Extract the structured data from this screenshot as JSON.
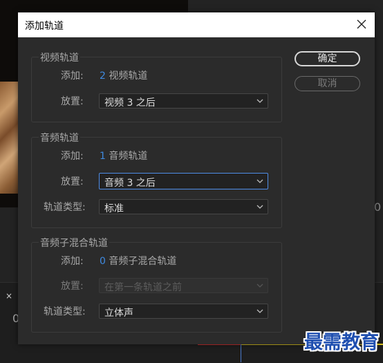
{
  "dialog": {
    "title": "添加轨道",
    "ok_label": "确定",
    "cancel_label": "取消"
  },
  "video": {
    "group_title": "视频轨道",
    "add_label": "添加:",
    "add_count": "2",
    "add_unit": "视频轨道",
    "placement_label": "放置:",
    "placement_value": "视频 3 之后"
  },
  "audio": {
    "group_title": "音频轨道",
    "add_label": "添加:",
    "add_count": "1",
    "add_unit": "音频轨道",
    "placement_label": "放置:",
    "placement_value": "音频 3 之后",
    "track_type_label": "轨道类型:",
    "track_type_value": "标准"
  },
  "submix": {
    "group_title": "音频子混合轨道",
    "add_label": "添加:",
    "add_count": "0",
    "add_unit": "音频子混合轨道",
    "placement_label": "放置:",
    "placement_value": "在第一条轨道之前",
    "track_type_label": "轨道类型:",
    "track_type_value": "立体声"
  },
  "background": {
    "close_glyph": "×",
    "zero_left": "0",
    "zero_right": "0"
  },
  "watermark": "最需教育",
  "colors": {
    "accent_number": "#3f8ae0",
    "focus_border": "#4f8ee8",
    "dialog_bg": "#2b2b2b"
  }
}
